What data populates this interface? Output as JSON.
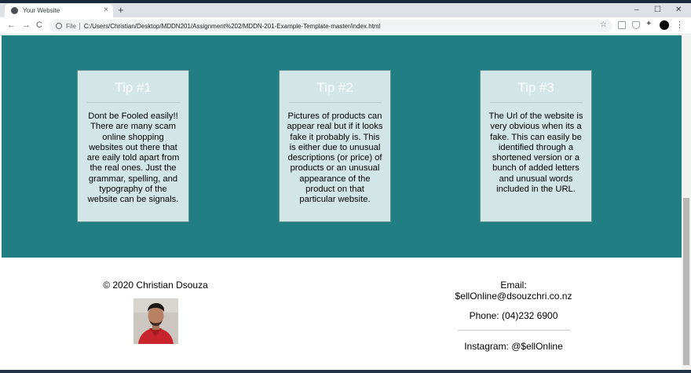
{
  "browser": {
    "tab_title": "Your Website",
    "tab_close": "×",
    "new_tab": "+",
    "window_controls": {
      "minimize": "–",
      "maximize": "☐",
      "close": "✕"
    },
    "nav": {
      "back": "←",
      "forward": "→",
      "reload": "C"
    },
    "file_label": "File",
    "url": "C:/Users/Christian/Desktop/MDDN201/Assignment%202/MDDN-201-Example-Template-master/index.html",
    "star": "☆",
    "extensions_icon": "✦",
    "menu": "⋮"
  },
  "tips": [
    {
      "title": "Tip #1",
      "body": "Dont be Fooled easily!! There are many scam online shopping websites out there that are eaily told apart from the real ones. Just the grammar, spelling, and typography of the website can be signals."
    },
    {
      "title": "Tip #2",
      "body": "Pictures of products can appear real but if it looks fake it probably is. This is either due to unusual descriptions (or price) of products or an unusual appearance of the product on that particular website."
    },
    {
      "title": "Tip #3",
      "body": "The Url of the website is very obvious when its a fake. This can easily be identified through a shortened version or a bunch of added letters and unusual words included in the URL."
    }
  ],
  "footer": {
    "copyright": "© 2020 Christian Dsouza",
    "email_label": "Email:",
    "email_value": "$ellOnline@dsouzchri.co.nz",
    "phone": "Phone: (04)232 6900",
    "instagram": "Instagram: @$ellOnline"
  },
  "colors": {
    "section_bg": "#217f83",
    "card_bg": "#d2e5e7"
  },
  "icons": [
    "globe-favicon-icon",
    "close-icon",
    "plus-icon",
    "back-arrow-icon",
    "forward-arrow-icon",
    "reload-icon",
    "info-icon",
    "star-icon",
    "extension-icon",
    "profile-avatar-icon",
    "menu-dots-icon"
  ]
}
